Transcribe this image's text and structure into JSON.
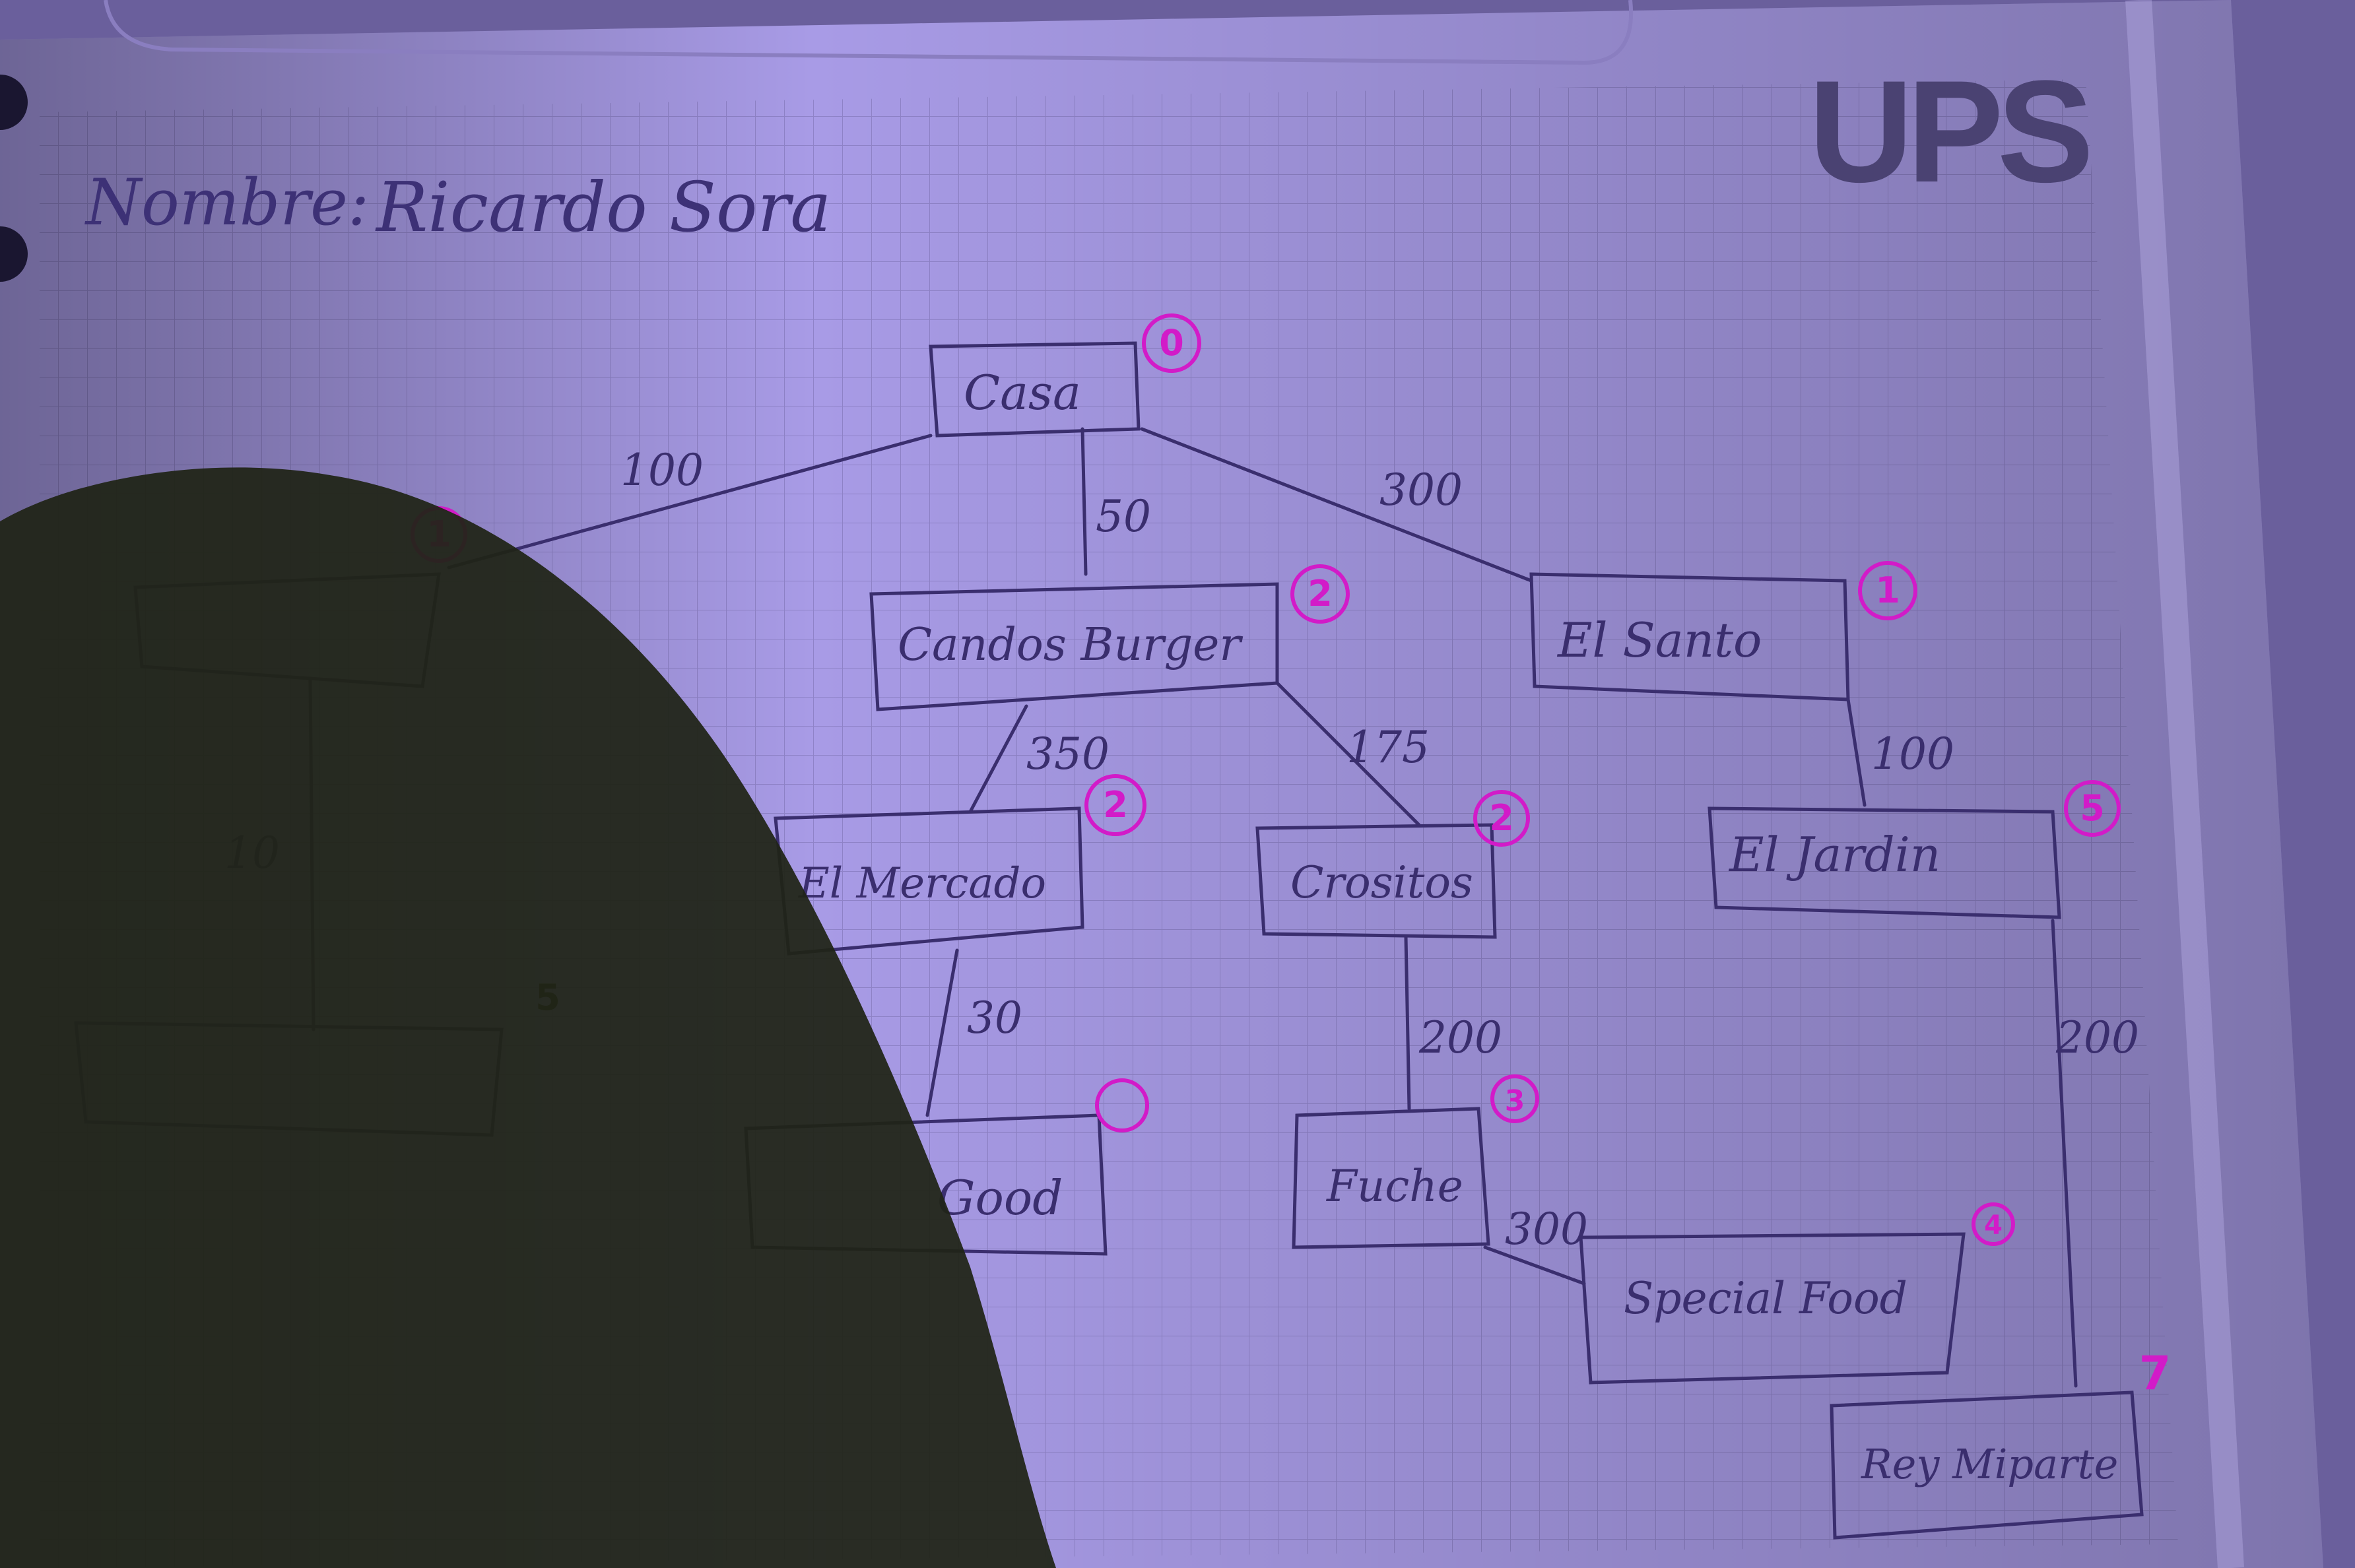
{
  "header": {
    "brand": "UPS",
    "name_label": "Nombre:",
    "name_value": "Ricardo Sora"
  },
  "nodes": {
    "casa": "Casa",
    "hidden_left": "",
    "candos_burger": "Candos Burger",
    "el_santo": "El Santo",
    "el_mercado": "El Mercado",
    "crositos": "Crositos",
    "el_jardin": "El Jardin",
    "bottom_left": "",
    "good": "Good",
    "fuche": "Fuche",
    "special_food": "Special Food",
    "rey": "Rey Miparte"
  },
  "order_marks": {
    "casa": "0",
    "hidden_left": "1",
    "candos_burger": "2",
    "el_santo": "1",
    "el_mercado": "2",
    "crositos": "2",
    "el_jardin": "5",
    "bottom_left": "5",
    "good": "",
    "fuche": "3",
    "special_food": "4",
    "rey": "7"
  },
  "edge_weights": {
    "casa_hidden": "100",
    "casa_candos": "50",
    "casa_santo": "300",
    "candos_mercado": "350",
    "candos_crositos": "175",
    "santo_jardin": "100",
    "hidden_bottom": "10",
    "mercado_good": "30",
    "crositos_fuche": "200",
    "fuche_special": "300",
    "jardin_rey": "200"
  },
  "colors": {
    "paper": "#a79ae6",
    "grid": "#8e82c6",
    "ink": "#3a2e6e",
    "pen_pink": "#d21bc8",
    "logo": "#4a4272",
    "shadow": "#1e2214"
  }
}
